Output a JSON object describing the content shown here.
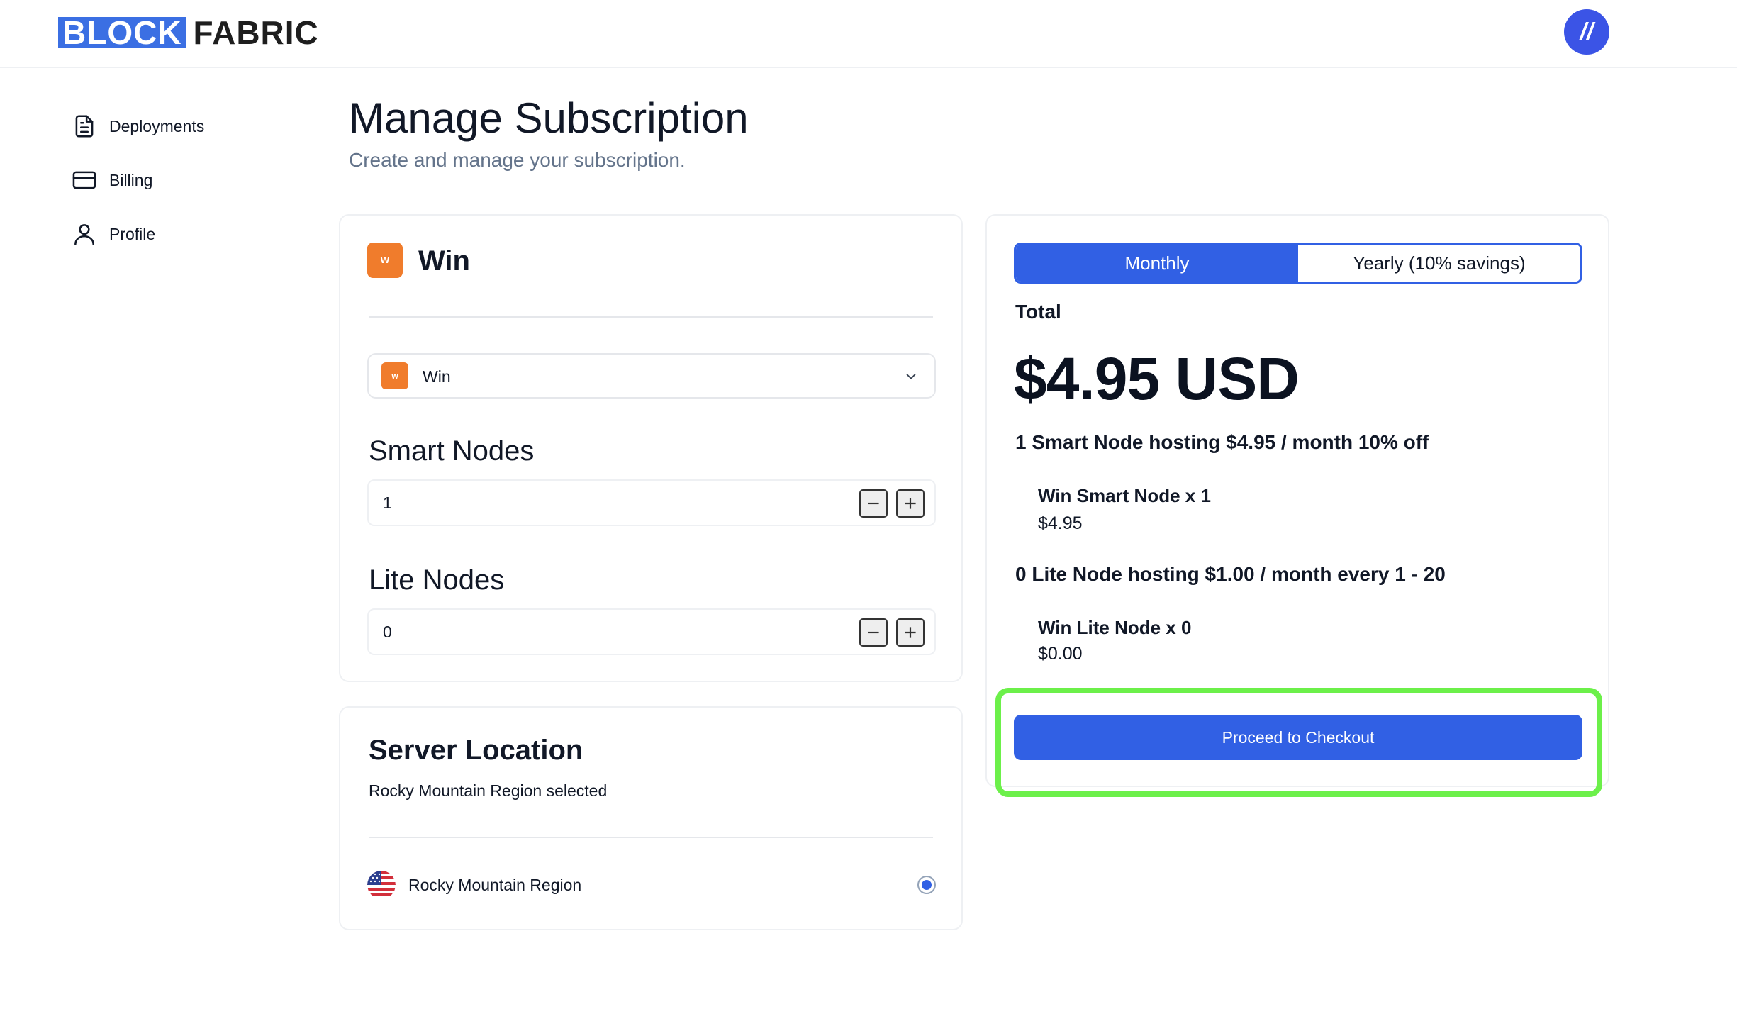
{
  "header": {
    "logo_block": "BLOCK",
    "logo_fabric": "FABRIC",
    "avatar_text": "//"
  },
  "sidebar": {
    "items": [
      {
        "label": "Deployments",
        "icon": "document-icon"
      },
      {
        "label": "Billing",
        "icon": "credit-card-icon"
      },
      {
        "label": "Profile",
        "icon": "user-icon"
      }
    ]
  },
  "page": {
    "title": "Manage Subscription",
    "subtitle": "Create and manage your subscription."
  },
  "project": {
    "badge": "w",
    "title": "Win",
    "select_value": "Win"
  },
  "smart_nodes": {
    "label": "Smart Nodes",
    "value": "1"
  },
  "lite_nodes": {
    "label": "Lite Nodes",
    "value": "0"
  },
  "location": {
    "title": "Server Location",
    "subtitle": "Rocky Mountain Region selected",
    "region_name": "Rocky Mountain Region"
  },
  "summary": {
    "toggle_monthly": "Monthly",
    "toggle_yearly": "Yearly (10% savings)",
    "total_label": "Total",
    "total_amount": "$4.95 USD",
    "smart_heading": "1 Smart Node hosting $4.95 / month 10% off",
    "smart_item": "Win Smart Node x 1",
    "smart_price": "$4.95",
    "lite_heading": "0 Lite Node hosting $1.00 / month every 1 - 20",
    "lite_item": "Win Lite Node x 0",
    "lite_price": "$0.00",
    "checkout_label": "Proceed to Checkout"
  },
  "colors": {
    "accent": "#3160e4",
    "logo_blue": "#3b6fe3",
    "project_badge": "#f07c2c",
    "highlight": "#6cf04a"
  }
}
